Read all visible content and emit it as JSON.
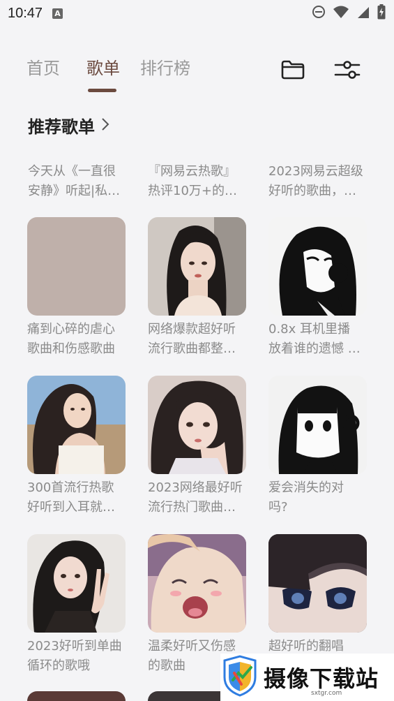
{
  "status_bar": {
    "time": "10:47",
    "notification_icon": "A"
  },
  "tabs": [
    {
      "label": "首页",
      "active": false
    },
    {
      "label": "歌单",
      "active": true
    },
    {
      "label": "排行榜",
      "active": false
    }
  ],
  "colors": {
    "accent": "#6b4a3f",
    "background": "#f4f4f6",
    "muted_text": "#8a8a8a"
  },
  "icons": {
    "folder": "folder-icon",
    "filter": "filter-sliders-icon"
  },
  "section": {
    "title": "推荐歌单"
  },
  "playlists_text_row": [
    {
      "title": "今天从《一直很\n安静》听起|私…"
    },
    {
      "title": "『网易云热歌』\n热评10万+的…"
    },
    {
      "title": "2023网易云超级\n好听的歌曲，…"
    }
  ],
  "playlists": [
    {
      "title": "痛到心碎的虐心\n歌曲和伤感歌曲"
    },
    {
      "title": "网络爆款超好听\n流行歌曲都整…"
    },
    {
      "title": "0.8x 耳机里播\n放着谁的遗憾 …"
    },
    {
      "title": "300首流行热歌\n好听到入耳就…"
    },
    {
      "title": "2023网络最好听\n流行热门歌曲…"
    },
    {
      "title": "爱会消失的对\n吗?"
    },
    {
      "title": "2023好听到单曲\n循环的歌哦"
    },
    {
      "title": "温柔好听又伤感\n的歌曲"
    },
    {
      "title": "超好听的翻唱"
    }
  ],
  "watermark": {
    "text": "摄像下载站",
    "url": "sxtgr.com"
  }
}
